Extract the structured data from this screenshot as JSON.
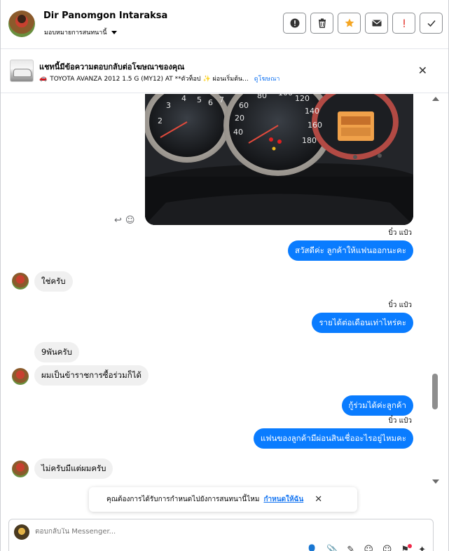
{
  "header": {
    "contact_name": "Dir Panomgon Intaraksa",
    "assign_label": "มอบหมายการสนทนานี้",
    "actions": [
      {
        "name": "report-icon",
        "glyph": "!"
      },
      {
        "name": "trash-icon",
        "glyph": "🗑"
      },
      {
        "name": "star-icon",
        "glyph": "★"
      },
      {
        "name": "envelope-icon",
        "glyph": "✉"
      },
      {
        "name": "exclamation-icon",
        "glyph": "!"
      },
      {
        "name": "check-icon",
        "glyph": "✓"
      }
    ]
  },
  "ad": {
    "title": "แชทนี้มีข้อความตอบกลับต่อโฆษณาของคุณ",
    "car_emoji": "🚗",
    "subtitle": "TOYOTA AVANZA 2012 1.5 G (MY12) AT **ตัวท็อป ✨ ผ่อนเริ่มต้น...",
    "link": "ดูโฆษณา",
    "close": "✕"
  },
  "messages": {
    "sender_1": "บิ๋ว แป๋ว",
    "out_1": "สวัสดีค่ะ ลูกค้าให้แฟนออกนะคะ",
    "in_1": "ใช่ครับ",
    "sender_2": "บิ๋ว แป๋ว",
    "out_2": "รายได้ต่อเดือนเท่าไหร่คะ",
    "in_2a": "9พันครับ",
    "in_2b": "ผมเป็นข้าราชการซื้อร่วมก็ได้",
    "out_3a": "กู้ร่วมได้ค่ะลูกค้า",
    "sender_3": "บิ๋ว แป๋ว",
    "out_3b": "แฟนของลูกค้ามีผ่อนสินเชื่ออะไรอยู่ไหมคะ",
    "in_3": "ไม่ครับมีแต่ผมครับ"
  },
  "photo": {
    "reply_icon": "↩",
    "emoji_icon": "☺"
  },
  "toast": {
    "text": "คุณต้องการได้รับการกำหนดไปยังการสนทนานี้ไหม",
    "link": "กำหนดให้ฉัน",
    "close": "✕"
  },
  "composer": {
    "placeholder": "ตอบกลับใน Messenger...",
    "tools": [
      "👤",
      "📎",
      "✎",
      "☺",
      "☺",
      "⚑",
      "✦"
    ]
  }
}
